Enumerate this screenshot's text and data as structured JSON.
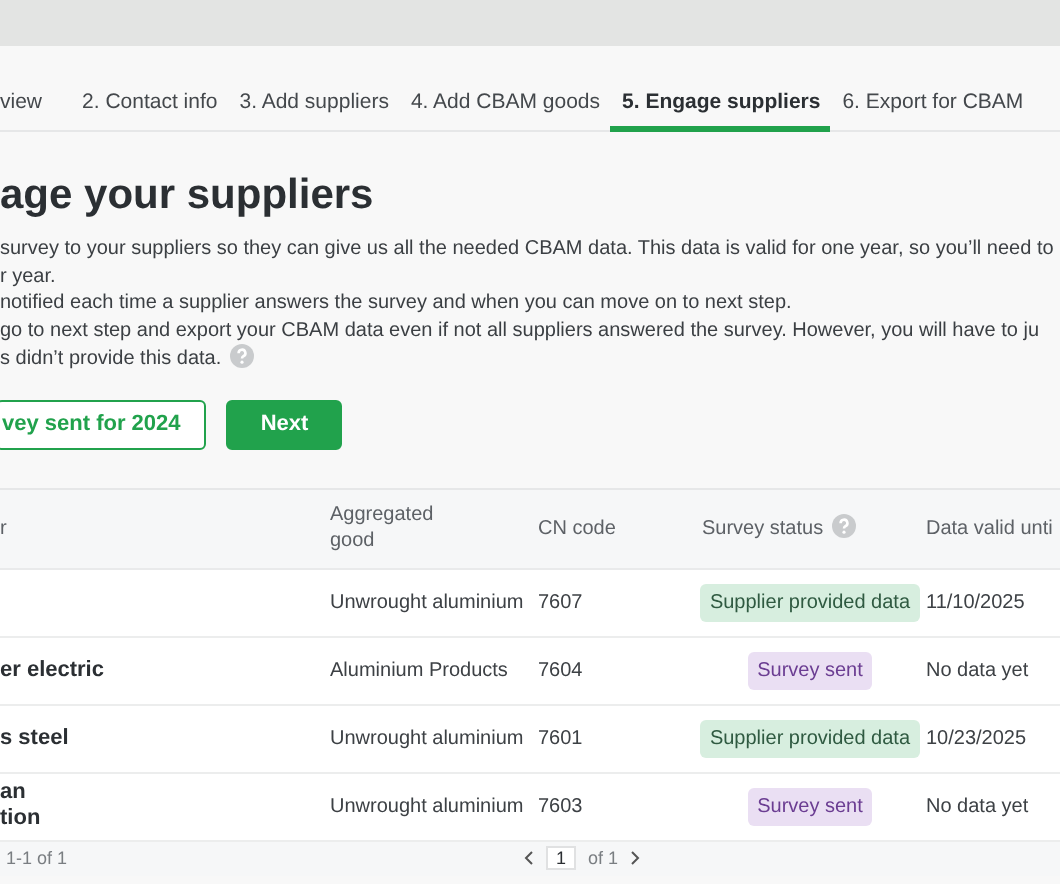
{
  "tabs": [
    {
      "label": "view",
      "selected": false
    },
    {
      "label": "2. Contact info",
      "selected": false
    },
    {
      "label": "3. Add suppliers",
      "selected": false
    },
    {
      "label": "4. Add CBAM goods",
      "selected": false
    },
    {
      "label": "5. Engage suppliers",
      "selected": true
    },
    {
      "label": "6. Export for CBAM",
      "selected": false
    }
  ],
  "title": "age your suppliers",
  "description": [
    "survey to your suppliers so they can give us all the needed CBAM data. This data is valid for one year, so you’ll need to",
    "r year.",
    "notified each time a supplier answers the survey and when you can move on to next step.",
    "go to next step and export your CBAM data even if not all suppliers answered the survey. However, you will have to ju",
    "s didn’t provide this data."
  ],
  "buttons": [
    {
      "label": "vey sent for 2024",
      "kind": "outline"
    },
    {
      "label": "Next",
      "kind": "primary"
    }
  ],
  "table": {
    "columns": [
      "r",
      "Aggregated good",
      "CN code",
      "Survey status",
      "Data valid unti"
    ],
    "rows": [
      {
        "good": "Unwrought aluminium",
        "cn_code": "7607",
        "status": {
          "label": "Supplier provided data",
          "kind": "provided"
        },
        "valid_until": "11/10/2025"
      },
      {
        "supplier": "er electric",
        "good": "Aluminium Products",
        "cn_code": "7604",
        "status": {
          "label": "Survey sent",
          "kind": "sent"
        },
        "valid_until": "No data yet"
      },
      {
        "supplier": "s steel",
        "good": "Unwrought aluminium",
        "cn_code": "7601",
        "status": {
          "label": "Supplier provided data",
          "kind": "provided"
        },
        "valid_until": "10/23/2025"
      },
      {
        "supplier": "an\ntion",
        "good": "Unwrought aluminium",
        "cn_code": "7603",
        "status": {
          "label": "Survey sent",
          "kind": "sent"
        },
        "valid_until": "No data yet"
      }
    ]
  },
  "pagination": {
    "range": "1-1 of 1",
    "page": "1",
    "of": "of 1"
  }
}
